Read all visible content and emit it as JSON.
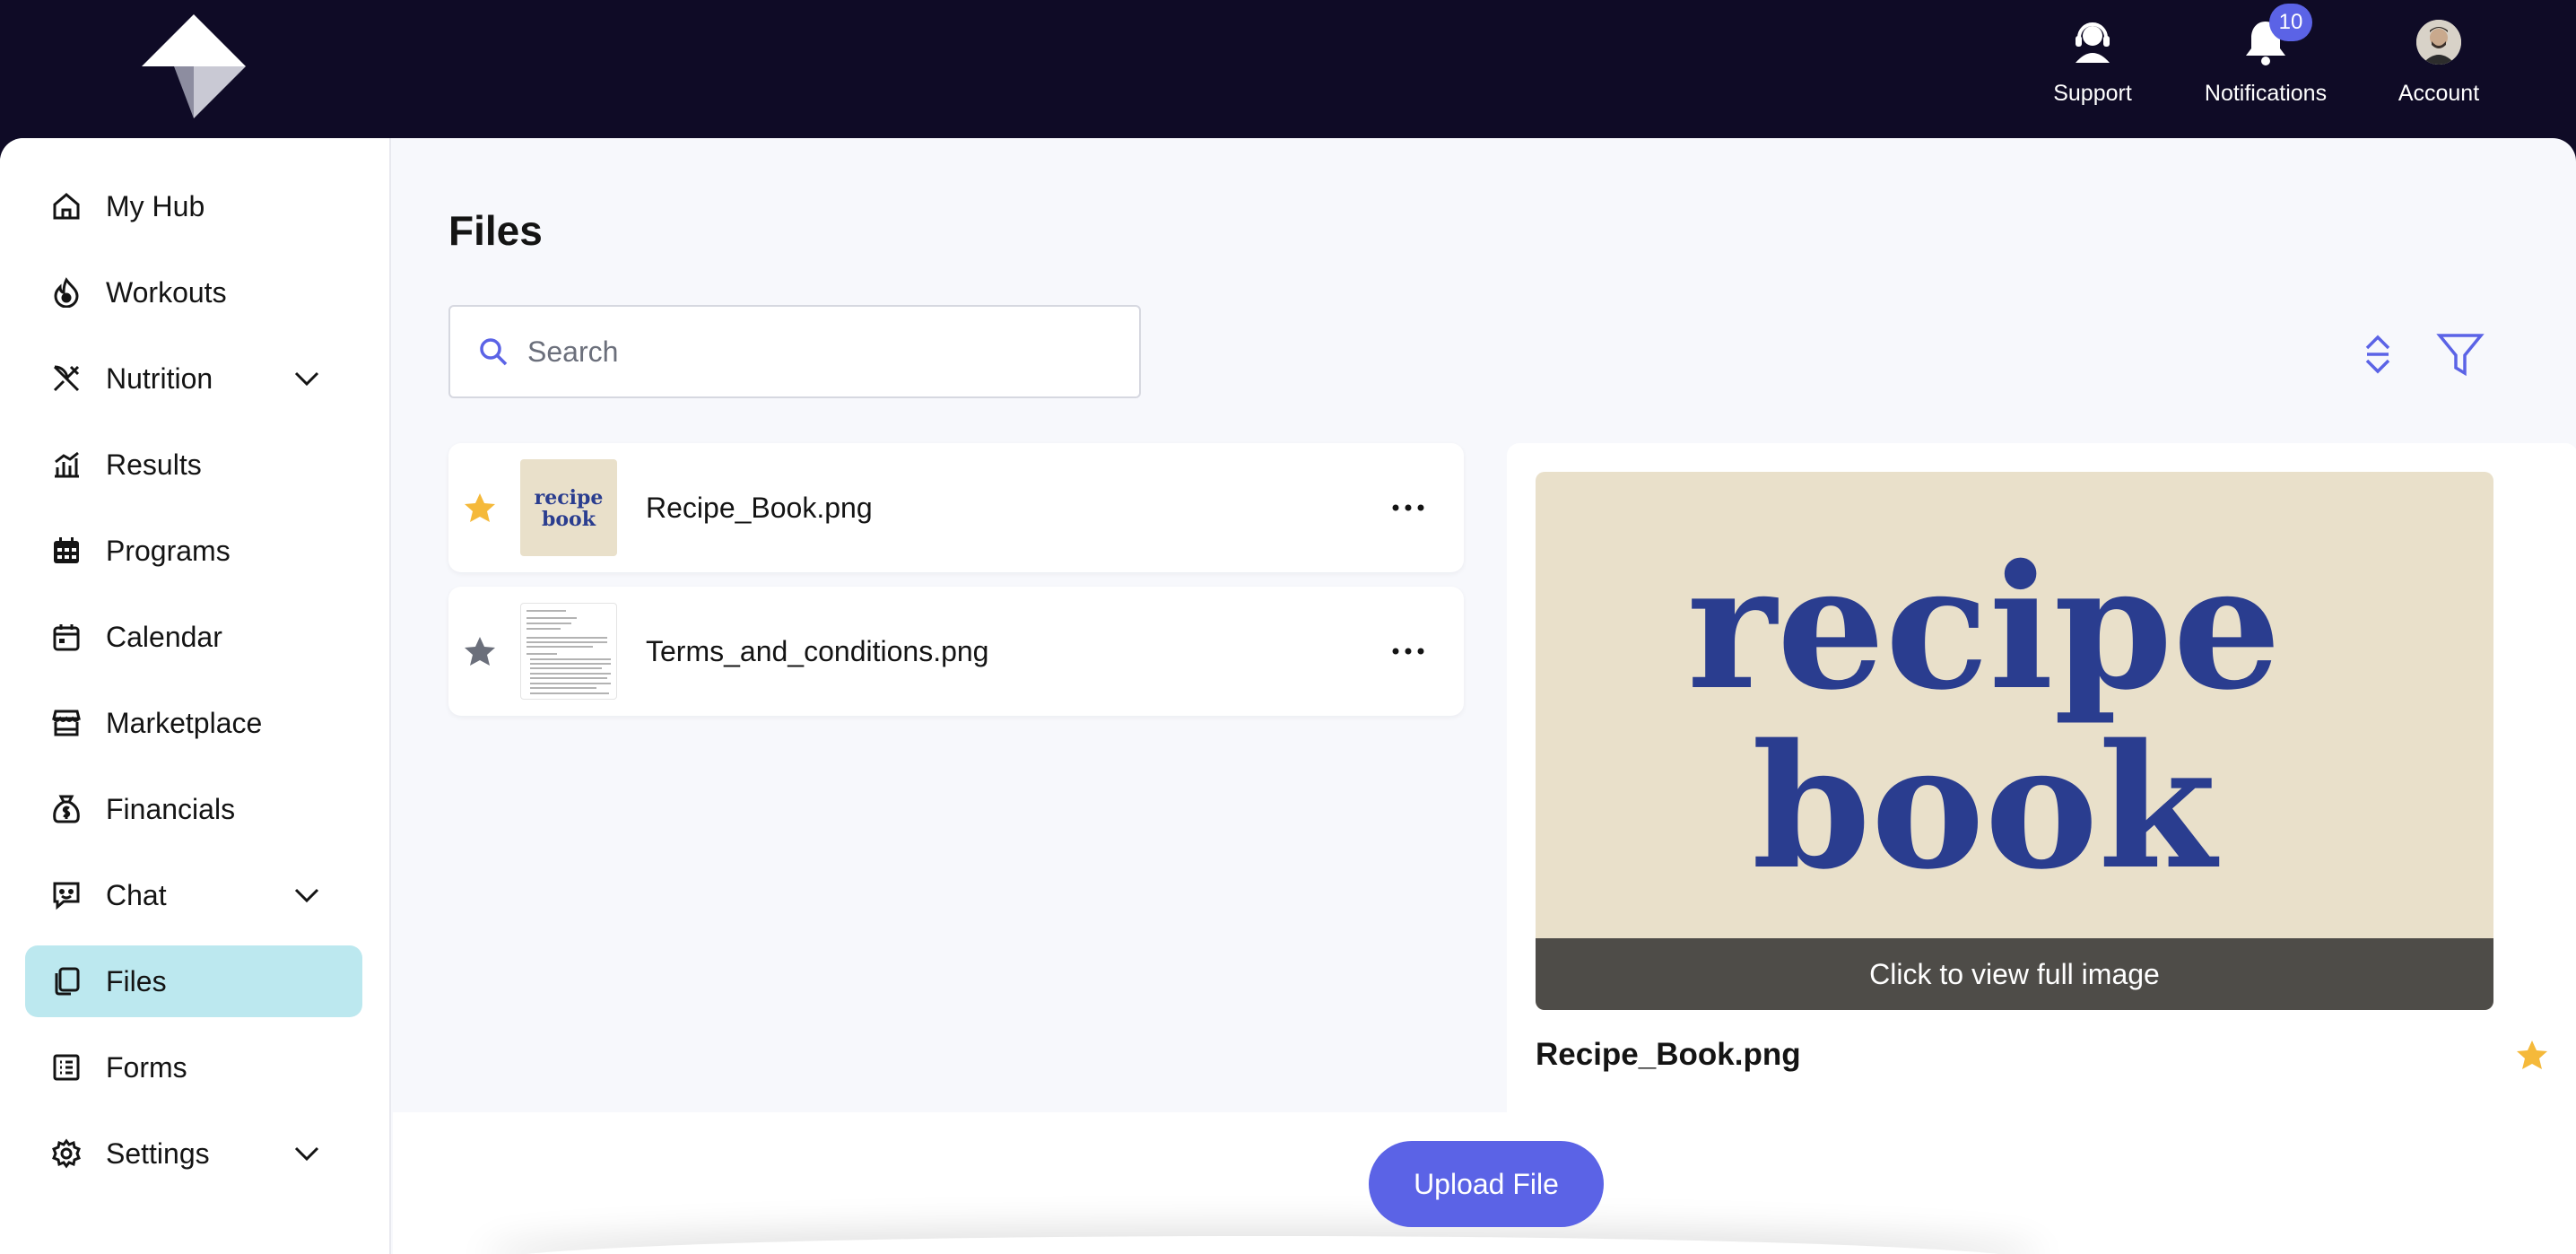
{
  "header": {
    "actions": [
      {
        "label": "Support",
        "icon": "headset-icon"
      },
      {
        "label": "Notifications",
        "icon": "bell-icon",
        "badge": "10"
      },
      {
        "label": "Account",
        "icon": "avatar"
      }
    ]
  },
  "sidebar": {
    "items": [
      {
        "label": "My Hub",
        "icon": "home-icon"
      },
      {
        "label": "Workouts",
        "icon": "flame-icon"
      },
      {
        "label": "Nutrition",
        "icon": "utensils-icon",
        "expandable": true
      },
      {
        "label": "Results",
        "icon": "chart-icon"
      },
      {
        "label": "Programs",
        "icon": "calendar-grid-icon"
      },
      {
        "label": "Calendar",
        "icon": "calendar-icon"
      },
      {
        "label": "Marketplace",
        "icon": "store-icon"
      },
      {
        "label": "Financials",
        "icon": "money-bag-icon"
      },
      {
        "label": "Chat",
        "icon": "chat-icon",
        "expandable": true
      },
      {
        "label": "Files",
        "icon": "files-icon",
        "active": true
      },
      {
        "label": "Forms",
        "icon": "form-icon"
      },
      {
        "label": "Settings",
        "icon": "gear-icon",
        "expandable": true
      }
    ]
  },
  "main": {
    "title": "Files",
    "search": {
      "placeholder": "Search",
      "value": ""
    },
    "files": [
      {
        "name": "Recipe_Book.png",
        "starred": true,
        "thumb_text": "recipe book"
      },
      {
        "name": "Terms_and_conditions.png",
        "starred": false
      }
    ],
    "preview": {
      "image_text_line1": "recipe",
      "image_text_line2": "book",
      "caption": "Click to view full image",
      "name": "Recipe_Book.png",
      "starred": true
    },
    "upload_label": "Upload File"
  },
  "colors": {
    "topbar": "#0f0b26",
    "accent": "#5b63e6",
    "active_nav": "#bce8ef",
    "star_active": "#f5b93a",
    "star_inactive": "#6b6f7b",
    "recipe_text": "#2a3d8f",
    "recipe_bg": "#e9e0ca"
  }
}
